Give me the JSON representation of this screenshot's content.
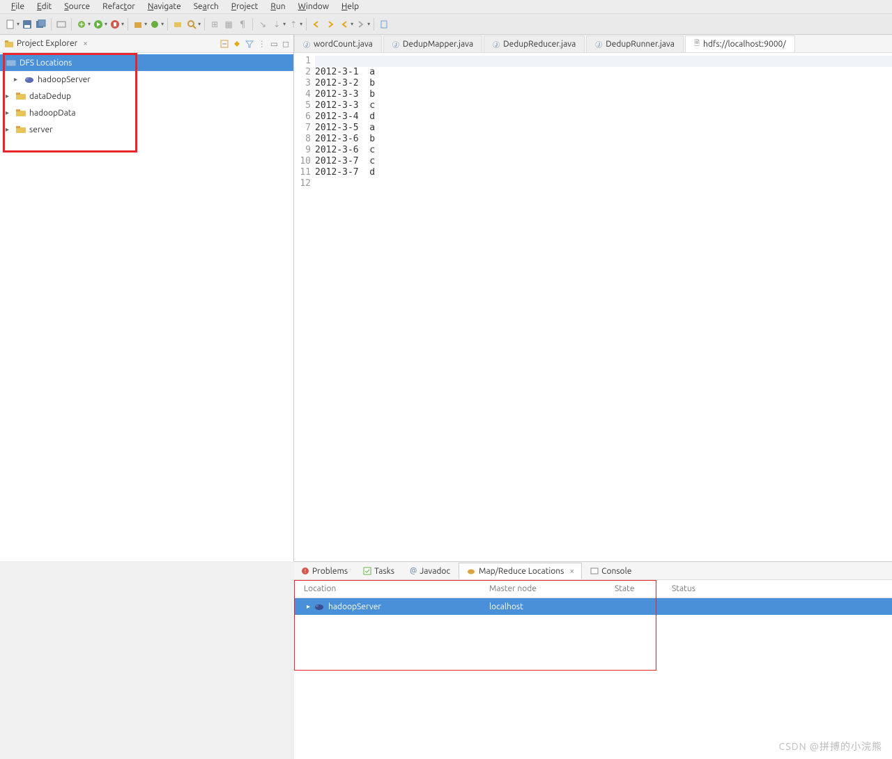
{
  "menu": {
    "items": [
      "File",
      "Edit",
      "Source",
      "Refactor",
      "Navigate",
      "Search",
      "Project",
      "Run",
      "Window",
      "Help"
    ]
  },
  "projectExplorer": {
    "title": "Project Explorer",
    "items": [
      {
        "label": "DFS Locations",
        "selected": true,
        "icon": "dfs"
      },
      {
        "label": "hadoopServer",
        "child": true,
        "icon": "elephant"
      },
      {
        "label": "dataDedup",
        "icon": "folder"
      },
      {
        "label": "hadoopData",
        "icon": "folder"
      },
      {
        "label": "server",
        "icon": "folder"
      }
    ]
  },
  "editorTabs": [
    {
      "label": "wordCount.java",
      "icon": "java"
    },
    {
      "label": "DedupMapper.java",
      "icon": "java"
    },
    {
      "label": "DedupReducer.java",
      "icon": "java"
    },
    {
      "label": "DedupRunner.java",
      "icon": "java"
    },
    {
      "label": "hdfs://localhost:9000/",
      "icon": "file"
    }
  ],
  "code": {
    "lines": [
      "",
      "2012-3-1  a",
      "2012-3-2  b",
      "2012-3-3  b",
      "2012-3-3  c",
      "2012-3-4  d",
      "2012-3-5  a",
      "2012-3-6  b",
      "2012-3-6  c",
      "2012-3-7  c",
      "2012-3-7  d",
      ""
    ]
  },
  "panelTabs": [
    {
      "label": "Problems",
      "icon": "problems"
    },
    {
      "label": "Tasks",
      "icon": "tasks"
    },
    {
      "label": "Javadoc",
      "icon": "javadoc"
    },
    {
      "label": "Map/Reduce Locations",
      "icon": "elephant",
      "active": true
    },
    {
      "label": "Console",
      "icon": "console"
    }
  ],
  "locationsTable": {
    "headers": [
      "Location",
      "Master node",
      "State",
      "Status"
    ],
    "row": {
      "location": "hadoopServer",
      "master": "localhost"
    }
  },
  "watermark": "CSDN @拼搏的小浣熊"
}
